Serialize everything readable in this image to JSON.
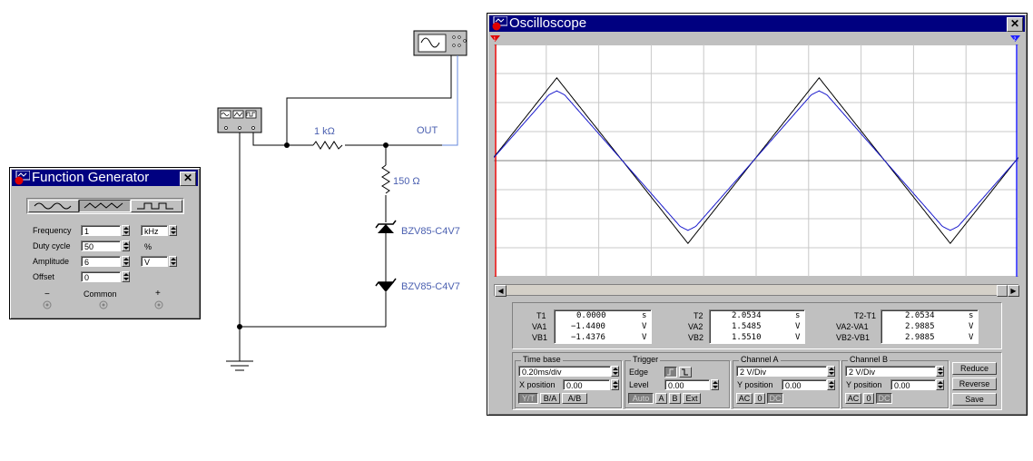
{
  "schematic": {
    "resistor1_label": "1 kΩ",
    "resistor2_label": "150 Ω",
    "out_label": "OUT",
    "zener1_label": "BZV85-C4V7",
    "zener2_label": "BZV85-C4V7"
  },
  "function_generator": {
    "title": "Function Generator",
    "waveforms": [
      "sine",
      "triangle",
      "square"
    ],
    "selected_waveform": "triangle",
    "frequency": {
      "label": "Frequency",
      "value": "1",
      "unit": "kHz"
    },
    "duty_cycle": {
      "label": "Duty cycle",
      "value": "50",
      "unit": "%"
    },
    "amplitude": {
      "label": "Amplitude",
      "value": "6",
      "unit": "V"
    },
    "offset": {
      "label": "Offset",
      "value": "0"
    },
    "terminals": {
      "minus": "−",
      "common": "Common",
      "plus": "+"
    }
  },
  "oscilloscope": {
    "title": "Oscilloscope",
    "readouts": {
      "t1": {
        "label": "T1",
        "value": "0.0000",
        "unit": "s"
      },
      "va1": {
        "label": "VA1",
        "value": "−1.4400",
        "unit": "V"
      },
      "vb1": {
        "label": "VB1",
        "value": "−1.4376",
        "unit": "V"
      },
      "t2": {
        "label": "T2",
        "value": "2.0534",
        "unit": "s"
      },
      "va2": {
        "label": "VA2",
        "value": "1.5485",
        "unit": "V"
      },
      "vb2": {
        "label": "VB2",
        "value": "1.5510",
        "unit": "V"
      },
      "t2t1": {
        "label": "T2-T1",
        "value": "2.0534",
        "unit": "s"
      },
      "va2va1": {
        "label": "VA2-VA1",
        "value": "2.9885",
        "unit": "V"
      },
      "vb2vb1": {
        "label": "VB2-VB1",
        "value": "2.9885",
        "unit": "V"
      }
    },
    "time_base": {
      "title": "Time base",
      "scale": "0.20ms/div",
      "x_position_label": "X position",
      "x_position": "0.00",
      "modes": [
        "Y/T",
        "B/A",
        "A/B"
      ],
      "selected_mode": "Y/T"
    },
    "trigger": {
      "title": "Trigger",
      "edge_label": "Edge",
      "level_label": "Level",
      "level": "0.00",
      "sources": [
        "Auto",
        "A",
        "B",
        "Ext"
      ],
      "selected_source": "Auto"
    },
    "channel_a": {
      "title": "Channel A",
      "scale": "2 V/Div",
      "y_position_label": "Y position",
      "y_position": "0.00",
      "coupling": [
        "AC",
        "0",
        "DC"
      ],
      "selected_coupling": "DC"
    },
    "channel_b": {
      "title": "Channel B",
      "scale": "2 V/Div",
      "y_position_label": "Y position",
      "y_position": "0.00",
      "coupling": [
        "AC",
        "0",
        "DC"
      ],
      "selected_coupling": "DC"
    },
    "buttons": {
      "reduce": "Reduce",
      "reverse": "Reverse",
      "save": "Save"
    },
    "trace": {
      "volts_per_div": 2,
      "divisions_vertical": 8,
      "divisions_horizontal": 10,
      "period_ms": 1,
      "ms_per_div": 0.2,
      "channel_a_peak_volts": 5.7,
      "channel_b_peak_volts": 4.9,
      "channel_a_color": "#000000",
      "channel_b_color": "#1a1acc"
    }
  },
  "colors": {
    "title_bar": "#000080",
    "window_face": "#c0c0c0",
    "wire": "#000000",
    "probe_wire": "#6688dd",
    "component_label": "#4a5fb0"
  }
}
